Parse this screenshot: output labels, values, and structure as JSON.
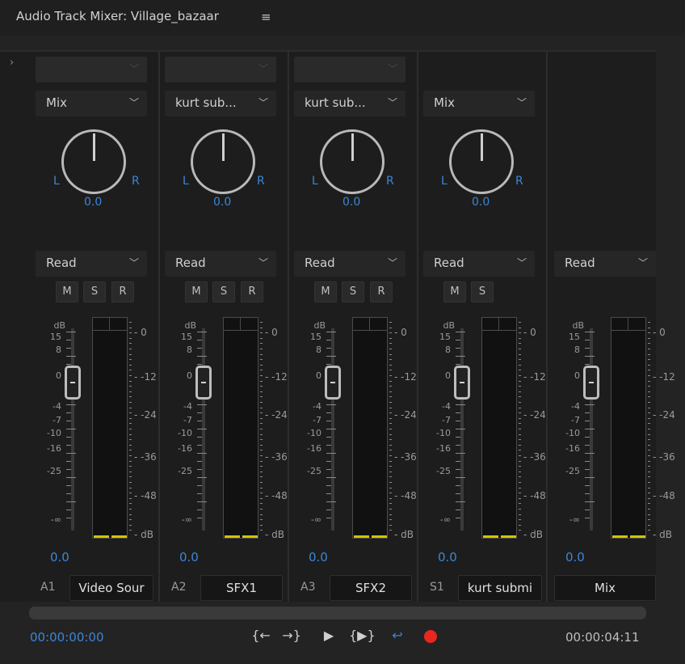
{
  "panel": {
    "title": "Audio Track Mixer: Village_bazaar",
    "menu_icon": "hamburger-icon"
  },
  "channels": [
    {
      "effect_value": "",
      "send": "Mix",
      "pan": "0.0",
      "pan_left": "L",
      "pan_right": "R",
      "automation": "Read",
      "buttons": [
        "M",
        "S",
        "R"
      ],
      "volume": "0.0",
      "track_id": "A1",
      "name": "Video Sour"
    },
    {
      "effect_value": "",
      "send": "kurt sub...",
      "pan": "0.0",
      "pan_left": "L",
      "pan_right": "R",
      "automation": "Read",
      "buttons": [
        "M",
        "S",
        "R"
      ],
      "volume": "0.0",
      "track_id": "A2",
      "name": "SFX1"
    },
    {
      "effect_value": "",
      "send": "kurt sub...",
      "pan": "0.0",
      "pan_left": "L",
      "pan_right": "R",
      "automation": "Read",
      "buttons": [
        "M",
        "S",
        "R"
      ],
      "volume": "0.0",
      "track_id": "A3",
      "name": "SFX2"
    },
    {
      "effect_value": null,
      "send": "Mix",
      "pan": "0.0",
      "pan_left": "L",
      "pan_right": "R",
      "automation": "Read",
      "buttons": [
        "M",
        "S"
      ],
      "volume": "0.0",
      "track_id": "S1",
      "name": "kurt submi"
    },
    {
      "effect_value": null,
      "send": null,
      "pan": null,
      "automation": "Read",
      "buttons": [],
      "volume": "0.0",
      "track_id": "",
      "name": "Mix"
    }
  ],
  "fader_scale": [
    "dB",
    "15",
    "8",
    "0",
    "-4",
    "-7",
    "-10",
    "-16",
    "-25",
    "-∞"
  ],
  "meter_scale": [
    "0",
    "-12",
    "-24",
    "-36",
    "-48",
    "dB"
  ],
  "transport": {
    "current_time": "00:00:00:00",
    "end_time": "00:00:04:11",
    "buttons": [
      "go-to-in-icon",
      "go-to-out-icon",
      "play-icon",
      "play-in-to-out-icon",
      "loop-icon",
      "record-icon"
    ]
  },
  "colors": {
    "accent_blue": "#3b86d8",
    "record_red": "#e8281f",
    "meter_level": "#d2c500"
  }
}
